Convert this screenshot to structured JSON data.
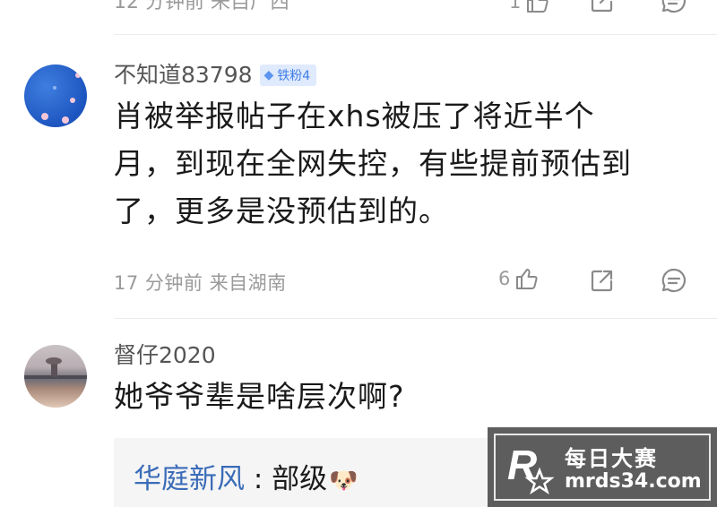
{
  "top_partial": {
    "meta": "12 分钟前   来自广西",
    "like_count": "1"
  },
  "comments": [
    {
      "username": "不知道83798",
      "badge": "铁粉4",
      "text_lines": [
        "肖被举报帖子在xhs被压了将近半个",
        "月，到现在全网失控，有些提前预估到",
        "了，更多是没预估到的。"
      ],
      "meta": "17 分钟前   来自湖南",
      "like_count": "6"
    },
    {
      "username": "督仔2020",
      "text": "她爷爷辈是啥层次啊?",
      "reply": {
        "name": "华庭新风",
        "separator": " : ",
        "text": "部级",
        "emoji": "🐶"
      }
    }
  ],
  "icons": {
    "like": "thumbs-up-icon",
    "share": "share-icon",
    "comment": "comment-icon"
  },
  "watermark": {
    "logo_letter": "R",
    "line1": "每日大赛",
    "line2": "mrds34.com"
  },
  "colors": {
    "badge_bg": "#dfeafd",
    "badge_text": "#3f7de6",
    "reply_name": "#3a6cb8",
    "meta": "#9a9a9a"
  }
}
